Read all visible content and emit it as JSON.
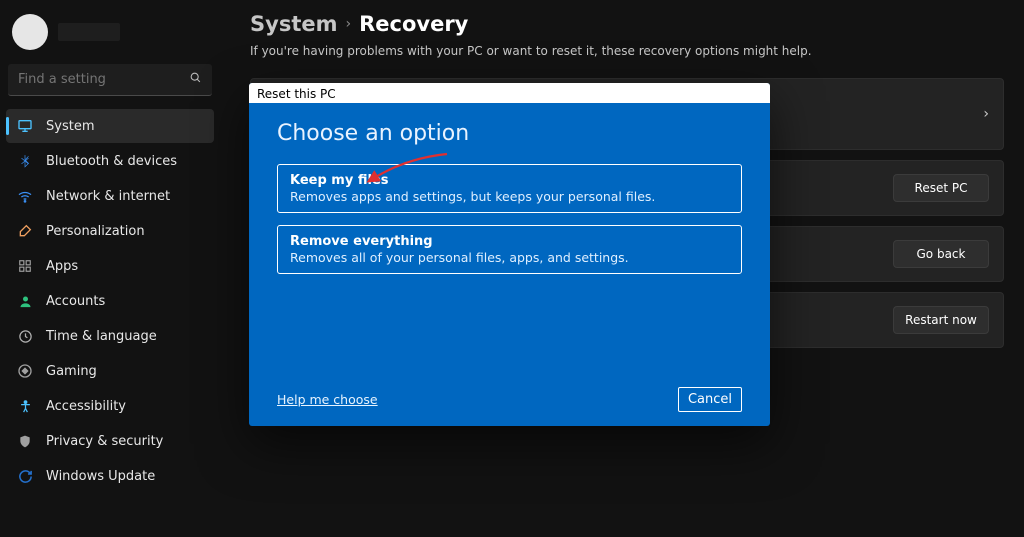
{
  "search": {
    "placeholder": "Find a setting"
  },
  "sidebar": {
    "items": [
      {
        "label": "System",
        "icon": "system",
        "color": "#4cc2ff"
      },
      {
        "label": "Bluetooth & devices",
        "icon": "bluetooth",
        "color": "#3a8ff3"
      },
      {
        "label": "Network & internet",
        "icon": "wifi",
        "color": "#3a8ff3"
      },
      {
        "label": "Personalization",
        "icon": "brush",
        "color": "#f0a060"
      },
      {
        "label": "Apps",
        "icon": "apps",
        "color": "#808080"
      },
      {
        "label": "Accounts",
        "icon": "person",
        "color": "#2ec27e"
      },
      {
        "label": "Time & language",
        "icon": "clock",
        "color": "#b0b0b0"
      },
      {
        "label": "Gaming",
        "icon": "gamepad",
        "color": "#808080"
      },
      {
        "label": "Accessibility",
        "icon": "accessibility",
        "color": "#4cc2ff"
      },
      {
        "label": "Privacy & security",
        "icon": "shield",
        "color": "#a0a0a0"
      },
      {
        "label": "Windows Update",
        "icon": "update",
        "color": "#2470cc"
      }
    ]
  },
  "breadcrumb": {
    "parent": "System",
    "current": "Recovery"
  },
  "description": "If you're having problems with your PC or want to reset it, these recovery options might help.",
  "cards": {
    "reset_label": "Reset PC",
    "goback_label": "Go back",
    "restart_label": "Restart now"
  },
  "dialog": {
    "titlebar": "Reset this PC",
    "heading": "Choose an option",
    "options": [
      {
        "title": "Keep my files",
        "sub": "Removes apps and settings, but keeps your personal files."
      },
      {
        "title": "Remove everything",
        "sub": "Removes all of your personal files, apps, and settings."
      }
    ],
    "help": "Help me choose",
    "cancel": "Cancel"
  }
}
